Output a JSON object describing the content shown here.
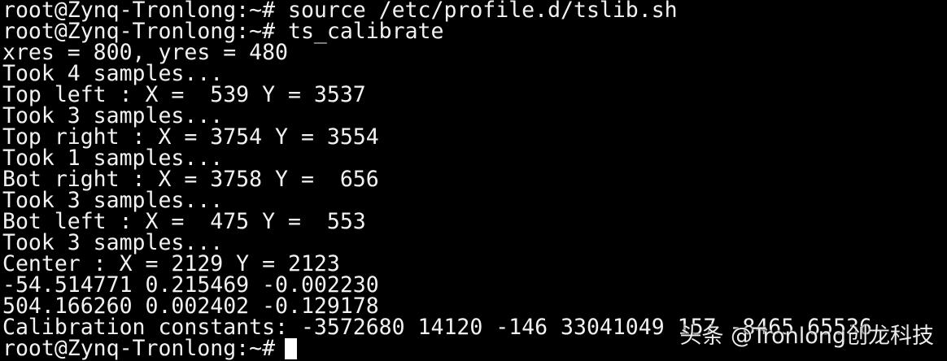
{
  "terminal": {
    "lines": [
      "root@Zynq-Tronlong:~# source /etc/profile.d/tslib.sh",
      "root@Zynq-Tronlong:~# ts_calibrate",
      "xres = 800, yres = 480",
      "Took 4 samples...",
      "Top left : X =  539 Y = 3537",
      "Took 3 samples...",
      "Top right : X = 3754 Y = 3554",
      "Took 1 samples...",
      "Bot right : X = 3758 Y =  656",
      "Took 3 samples...",
      "Bot left : X =  475 Y =  553",
      "Took 3 samples...",
      "Center : X = 2129 Y = 2123",
      "-54.514771 0.215469 -0.002230",
      "504.166260 0.002402 -0.129178",
      "Calibration constants: -3572680 14120 -146 33041049 157 -8465 65536"
    ],
    "prompt": "root@Zynq-Tronlong:~#"
  },
  "watermark": {
    "text": "头条 @Tronlong创龙科技"
  },
  "colors": {
    "background": "#000000",
    "foreground": "#f2f2f2",
    "cursor": "#ffffff"
  }
}
